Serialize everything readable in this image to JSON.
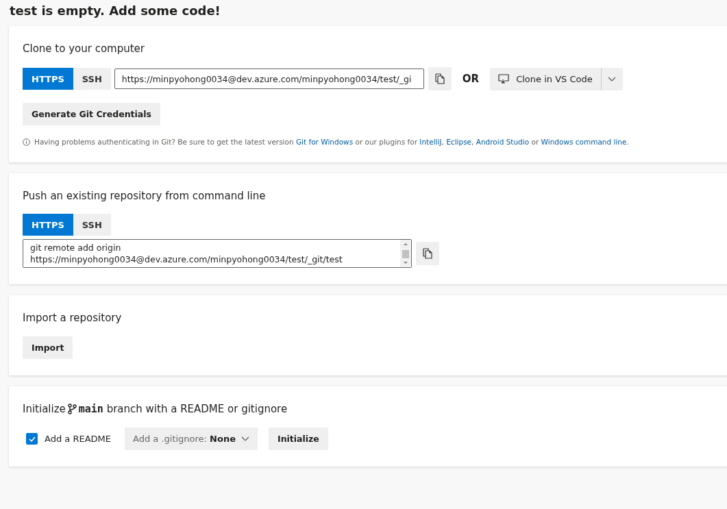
{
  "page_title": "test is empty. Add some code!",
  "clone": {
    "title": "Clone to your computer",
    "tabs": [
      {
        "label": "HTTPS",
        "selected": true
      },
      {
        "label": "SSH",
        "selected": false
      }
    ],
    "url": "https://minpyohong0034@dev.azure.com/minpyohong0034/test/_gi",
    "or": "OR",
    "vscode_button": "Clone in VS Code",
    "credentials_button": "Generate Git Credentials",
    "help": [
      {
        "kind": "text",
        "text": "Having problems authenticating in Git? Be sure to get the latest version "
      },
      {
        "kind": "link",
        "text": "Git for Windows"
      },
      {
        "kind": "text",
        "text": " or our plugins for "
      },
      {
        "kind": "link",
        "text": "IntelliJ"
      },
      {
        "kind": "text",
        "text": ", "
      },
      {
        "kind": "link",
        "text": "Eclipse"
      },
      {
        "kind": "text",
        "text": ", "
      },
      {
        "kind": "link",
        "text": "Android Studio"
      },
      {
        "kind": "text",
        "text": " or "
      },
      {
        "kind": "link",
        "text": "Windows command line"
      },
      {
        "kind": "text",
        "text": "."
      }
    ]
  },
  "push": {
    "title": "Push an existing repository from command line",
    "tabs": [
      {
        "label": "HTTPS",
        "selected": true
      },
      {
        "label": "SSH",
        "selected": false
      }
    ],
    "command": "git remote add origin\nhttps://minpyohong0034@dev.azure.com/minpyohong0034/test/_git/test"
  },
  "import": {
    "title": "Import a repository",
    "button": "Import"
  },
  "init": {
    "title_before": "Initialize",
    "branch": "main",
    "title_after": " branch with a README or gitignore",
    "readme": {
      "label": "Add a README",
      "checked": true
    },
    "gitignore": {
      "label": "Add a .gitignore: ",
      "value": "None"
    },
    "button": "Initialize"
  }
}
